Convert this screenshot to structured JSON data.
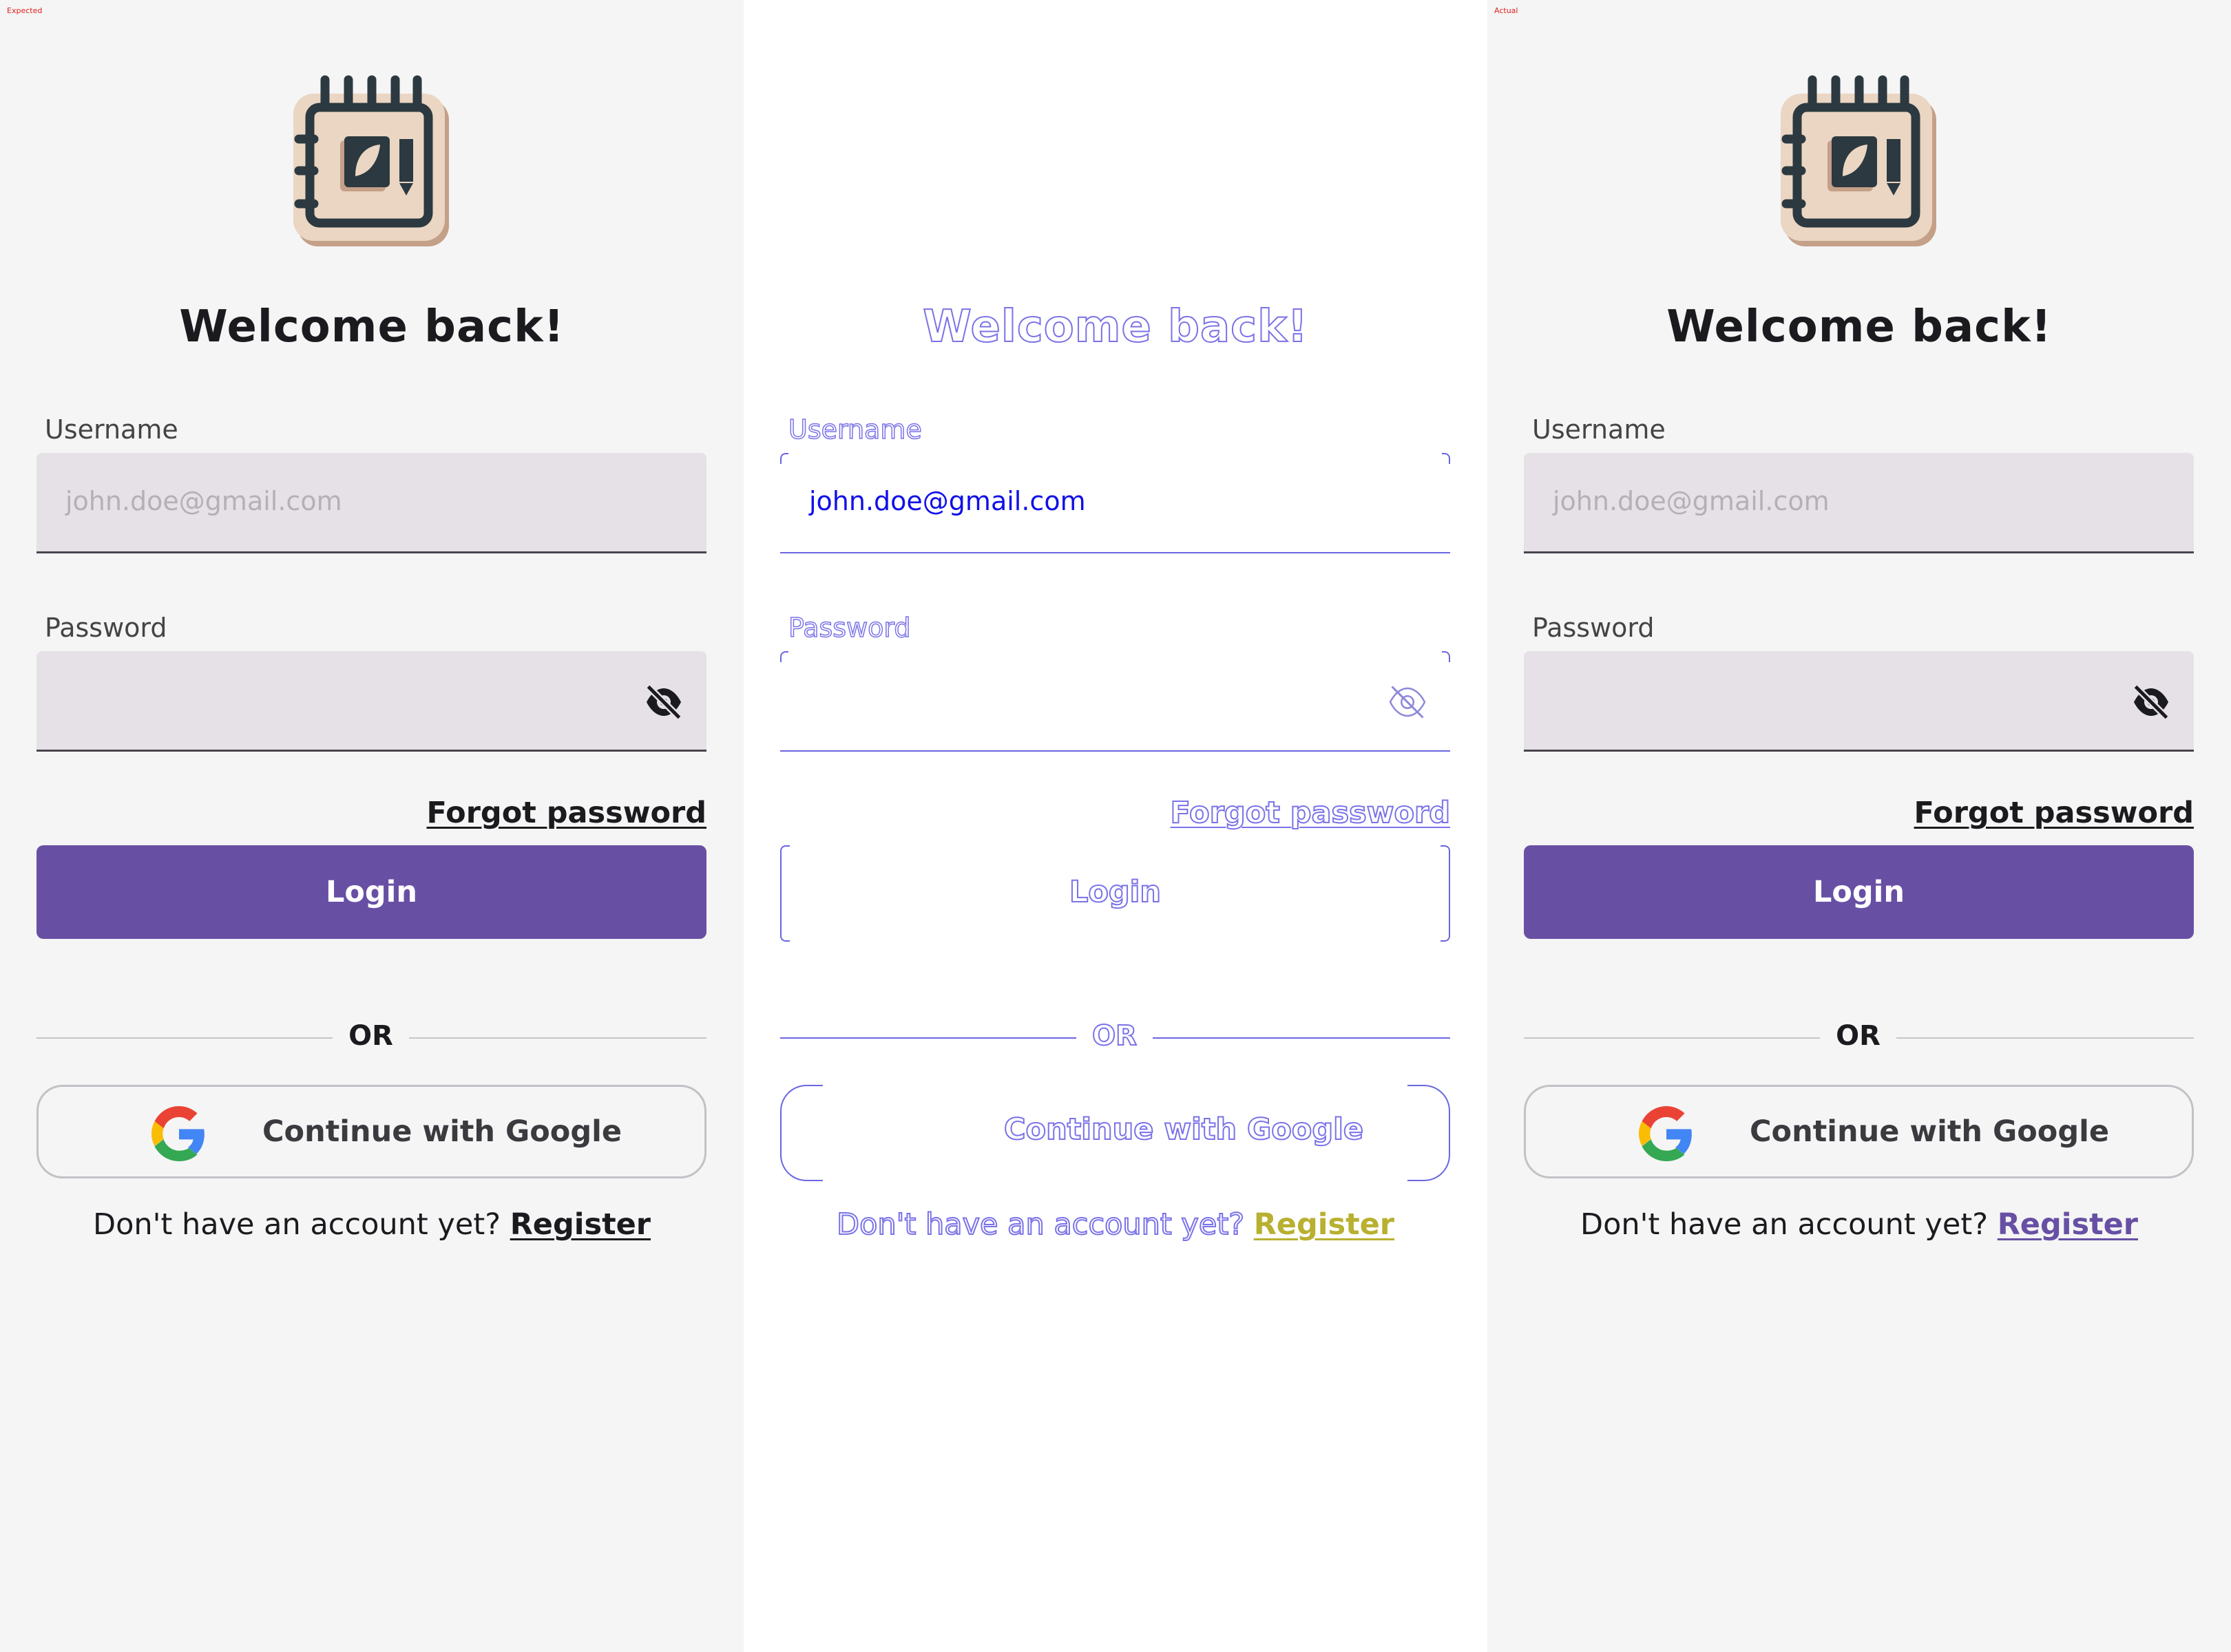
{
  "panels": {
    "expected_label": "Expected",
    "actual_label": "Actual"
  },
  "screen": {
    "title": "Welcome back!",
    "username": {
      "label": "Username",
      "placeholder": "john.doe@gmail.com"
    },
    "password": {
      "label": "Password",
      "value": ""
    },
    "forgot_password": "Forgot password",
    "login_button": "Login",
    "divider_text": "OR",
    "google_button": "Continue with Google",
    "register_prompt": "Don't have an account yet? ",
    "register_link": "Register"
  },
  "diff": {
    "username_value": "john.doe@gmail.com"
  },
  "icons": {
    "app_logo": "notebook-pencil-icon",
    "password_toggle": "eye-off-icon",
    "google": "google-g-icon"
  },
  "colors": {
    "primary": "#6750a4",
    "background": "#f5f5f5",
    "field_background": "#e6e1e6",
    "text_dark": "#1b1b1f",
    "diff_outline": "#7a72e8",
    "diff_link": "#b8b030",
    "label_red": "#e02020"
  }
}
